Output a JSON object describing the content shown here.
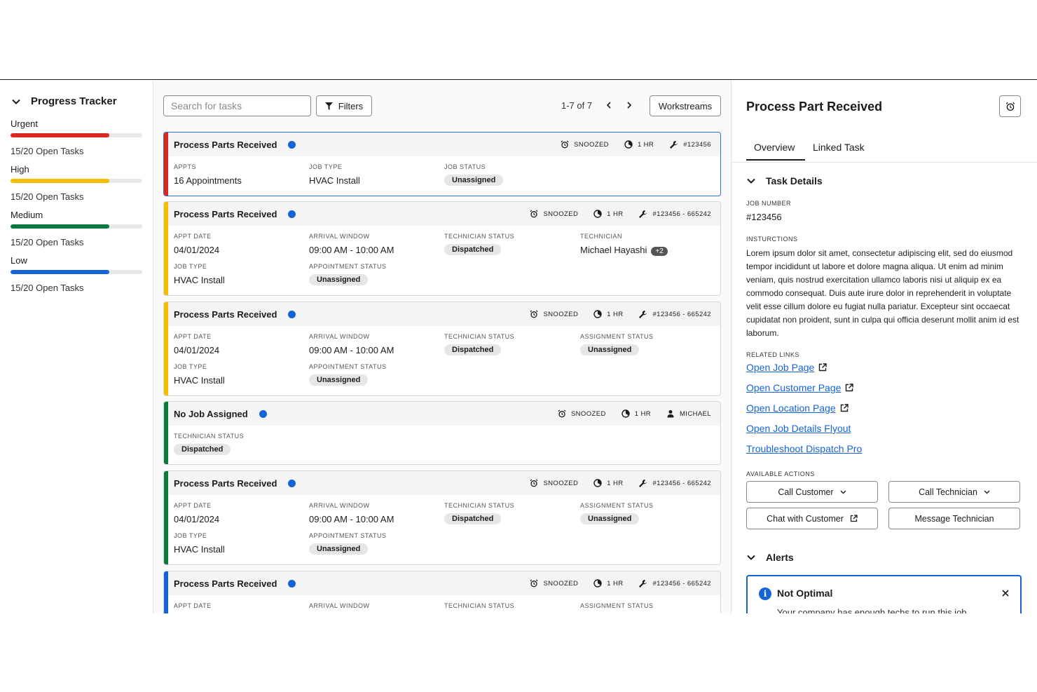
{
  "colors": {
    "accent": "#1464d8",
    "urgent": "#d9281d",
    "high": "#f5bd00",
    "medium": "#0a7a3e",
    "low": "#1464d8"
  },
  "sidebar": {
    "title": "Progress Tracker",
    "levels": [
      {
        "name": "Urgent",
        "count": "15/20 Open Tasks",
        "progress": 0.75,
        "color": "#d9281d"
      },
      {
        "name": "High",
        "count": "15/20 Open Tasks",
        "progress": 0.75,
        "color": "#f5bd00"
      },
      {
        "name": "Medium",
        "count": "15/20 Open Tasks",
        "progress": 0.75,
        "color": "#0a7a3e"
      },
      {
        "name": "Low",
        "count": "15/20 Open Tasks",
        "progress": 0.75,
        "color": "#1464d8"
      }
    ]
  },
  "toolbar": {
    "search_placeholder": "Search for tasks",
    "filters_label": "Filters",
    "pagination": "1-7 of 7",
    "workstreams_label": "Workstreams"
  },
  "tasks": [
    {
      "title": "Process Parts Received",
      "status": "SNOOZED",
      "duration": "1 HR",
      "ref": "#123456",
      "color": "#d9281d",
      "fields": [
        {
          "label": "APPTS",
          "value": "16 Appointments"
        },
        {
          "label": "JOB TYPE",
          "value": "HVAC Install"
        },
        {
          "label": "JOB STATUS",
          "value": "Unassigned"
        }
      ]
    },
    {
      "title": "Process Parts Received",
      "status": "SNOOZED",
      "duration": "1 HR",
      "ref": "#123456 - 665242",
      "color": "#f5bd00",
      "fields": [
        {
          "label": "APPT DATE",
          "value": "04/01/2024"
        },
        {
          "label": "ARRIVAL WINDOW",
          "value": "09:00 AM - 10:00 AM"
        },
        {
          "label": "TECHNICIAN STATUS",
          "value": "Dispatched"
        },
        {
          "label": "TECHNICIAN",
          "value": "Michael Hayashi",
          "extra": "+2"
        },
        {
          "label": "JOB TYPE",
          "value": "HVAC Install"
        },
        {
          "label": "APPOINTMENT STATUS",
          "value": "Unassigned"
        }
      ]
    },
    {
      "title": "Process Parts Received",
      "status": "SNOOZED",
      "duration": "1 HR",
      "ref": "#123456 - 665242",
      "color": "#f5bd00",
      "fields": [
        {
          "label": "APPT DATE",
          "value": "04/01/2024"
        },
        {
          "label": "ARRIVAL WINDOW",
          "value": "09:00 AM - 10:00 AM"
        },
        {
          "label": "TECHNICIAN STATUS",
          "value": "Dispatched"
        },
        {
          "label": "ASSIGNMENT STATUS",
          "value": "Unassigned"
        },
        {
          "label": "JOB TYPE",
          "value": "HVAC Install"
        },
        {
          "label": "APPOINTMENT STATUS",
          "value": "Unassigned"
        }
      ]
    },
    {
      "title": "No Job Assigned",
      "status": "SNOOZED",
      "duration": "1 HR",
      "ref": "MICHAEL",
      "color": "#0a7a3e",
      "fields": [
        {
          "label": "TECHNICIAN STATUS",
          "value": "Dispatched"
        }
      ]
    },
    {
      "title": "Process Parts Received",
      "status": "SNOOZED",
      "duration": "1 HR",
      "ref": "#123456 - 665242",
      "color": "#0a7a3e",
      "fields": [
        {
          "label": "APPT DATE",
          "value": "04/01/2024"
        },
        {
          "label": "ARRIVAL WINDOW",
          "value": "09:00 AM - 10:00 AM"
        },
        {
          "label": "TECHNICIAN STATUS",
          "value": "Dispatched"
        },
        {
          "label": "ASSIGNMENT STATUS",
          "value": "Unassigned"
        },
        {
          "label": "JOB TYPE",
          "value": "HVAC Install"
        },
        {
          "label": "APPOINTMENT STATUS",
          "value": "Unassigned"
        }
      ]
    },
    {
      "title": "Process Parts Received",
      "status": "SNOOZED",
      "duration": "1 HR",
      "ref": "#123456 - 665242",
      "color": "#1464d8",
      "fields": [
        {
          "label": "APPT DATE",
          "value": ""
        },
        {
          "label": "ARRIVAL WINDOW",
          "value": ""
        },
        {
          "label": "TECHNICIAN STATUS",
          "value": ""
        },
        {
          "label": "ASSIGNMENT STATUS",
          "value": ""
        }
      ]
    }
  ],
  "detail": {
    "title": "Process Part Received",
    "tabs": [
      "Overview",
      "Linked Task"
    ],
    "task_details_title": "Task Details",
    "job_number_label": "JOB NUMBER",
    "job_number": "#123456",
    "instructions_label": "INSTURCTIONS",
    "instructions": "Lorem ipsum dolor sit amet, consectetur adipiscing elit, sed do eiusmod tempor incididunt ut labore et dolore magna aliqua. Ut enim ad minim veniam, quis nostrud exercitation ullamco laboris nisi ut aliquip ex ea commodo consequat. Duis aute irure dolor in reprehenderit in voluptate velit esse cillum dolore eu fugiat nulla pariatur. Excepteur sint occaecat cupidatat non proident, sunt in culpa qui officia deserunt mollit anim id est laborum.",
    "related_links_label": "RELATED LINKS",
    "links": [
      {
        "label": "Open Job Page",
        "external": true
      },
      {
        "label": "Open Customer Page",
        "external": true
      },
      {
        "label": "Open Location Page",
        "external": true
      },
      {
        "label": "Open Job Details Flyout",
        "external": false
      },
      {
        "label": "Troubleshoot Dispatch Pro",
        "external": false
      }
    ],
    "actions_label": "AVAILABLE ACTIONS",
    "actions": {
      "call_customer": "Call Customer",
      "call_technician": "Call Technician",
      "chat_customer": "Chat with Customer",
      "message_technician": "Message Technician"
    },
    "alerts_title": "Alerts",
    "alert": {
      "title": "Not Optimal",
      "message": "Your company has enough techs to run this job"
    }
  }
}
